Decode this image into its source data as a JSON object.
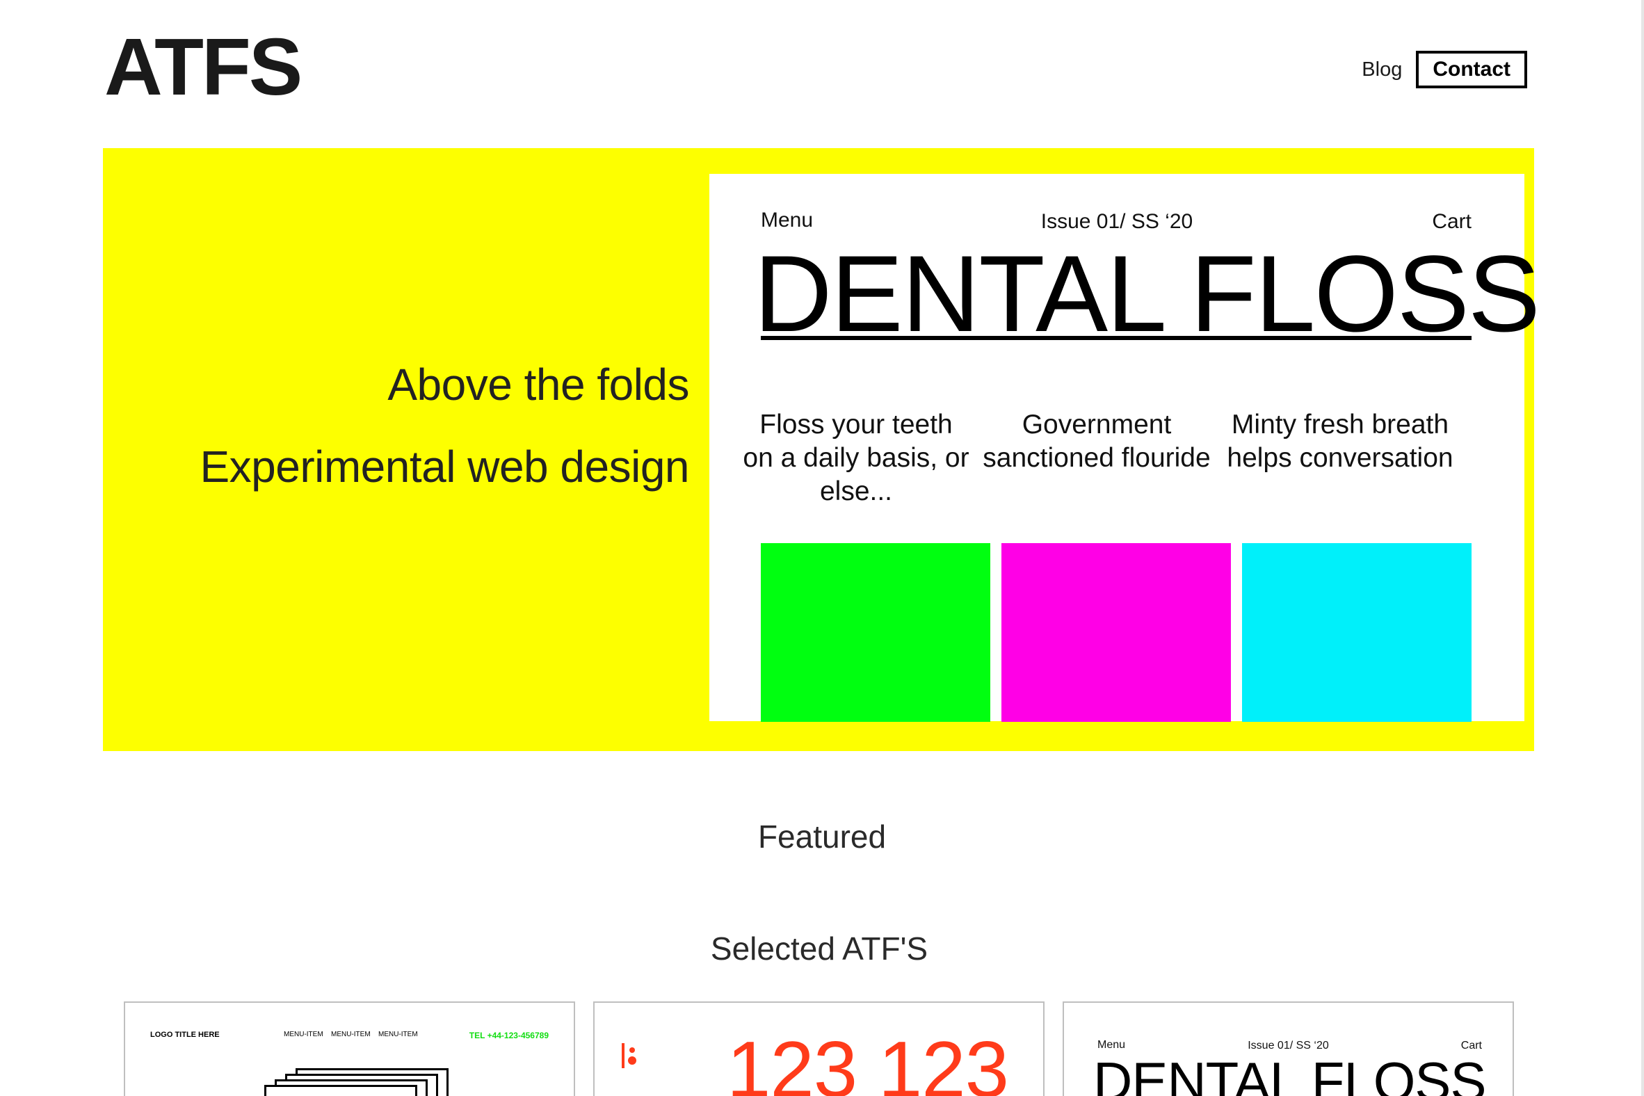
{
  "header": {
    "logo": "ATFS",
    "nav": {
      "blog": "Blog",
      "contact": "Contact"
    }
  },
  "hero": {
    "title": "Above the folds",
    "subtitle": "Experimental web design",
    "background": "#fdff00",
    "mockup": {
      "menu": "Menu",
      "issue": "Issue 01/ SS ‘20",
      "cart": "Cart",
      "title": "DENTAL FLOSS",
      "columns": [
        {
          "text": "Floss your teeth on a daily basis, or else...",
          "color": "#00ff10"
        },
        {
          "text": "Government sanctioned flouride",
          "color": "#ff00e6"
        },
        {
          "text": "Minty fresh breath helps conversation",
          "color": "#00f0fa"
        }
      ]
    }
  },
  "sections": {
    "featured": "Featured",
    "selected": "Selected ATF'S"
  },
  "cards": [
    {
      "logo": "LOGO TITLE HERE",
      "menu": [
        "MENU-ITEM",
        "MENU-ITEM",
        "MENU-ITEM"
      ],
      "tel": "TEL +44-123-456789"
    },
    {
      "icon": "dots-icon",
      "number": "123 123",
      "accent": "#ff3b1a"
    },
    {
      "menu": "Menu",
      "issue": "Issue 01/ SS ‘20",
      "cart": "Cart",
      "title": "DENTAL FLOSS"
    }
  ]
}
